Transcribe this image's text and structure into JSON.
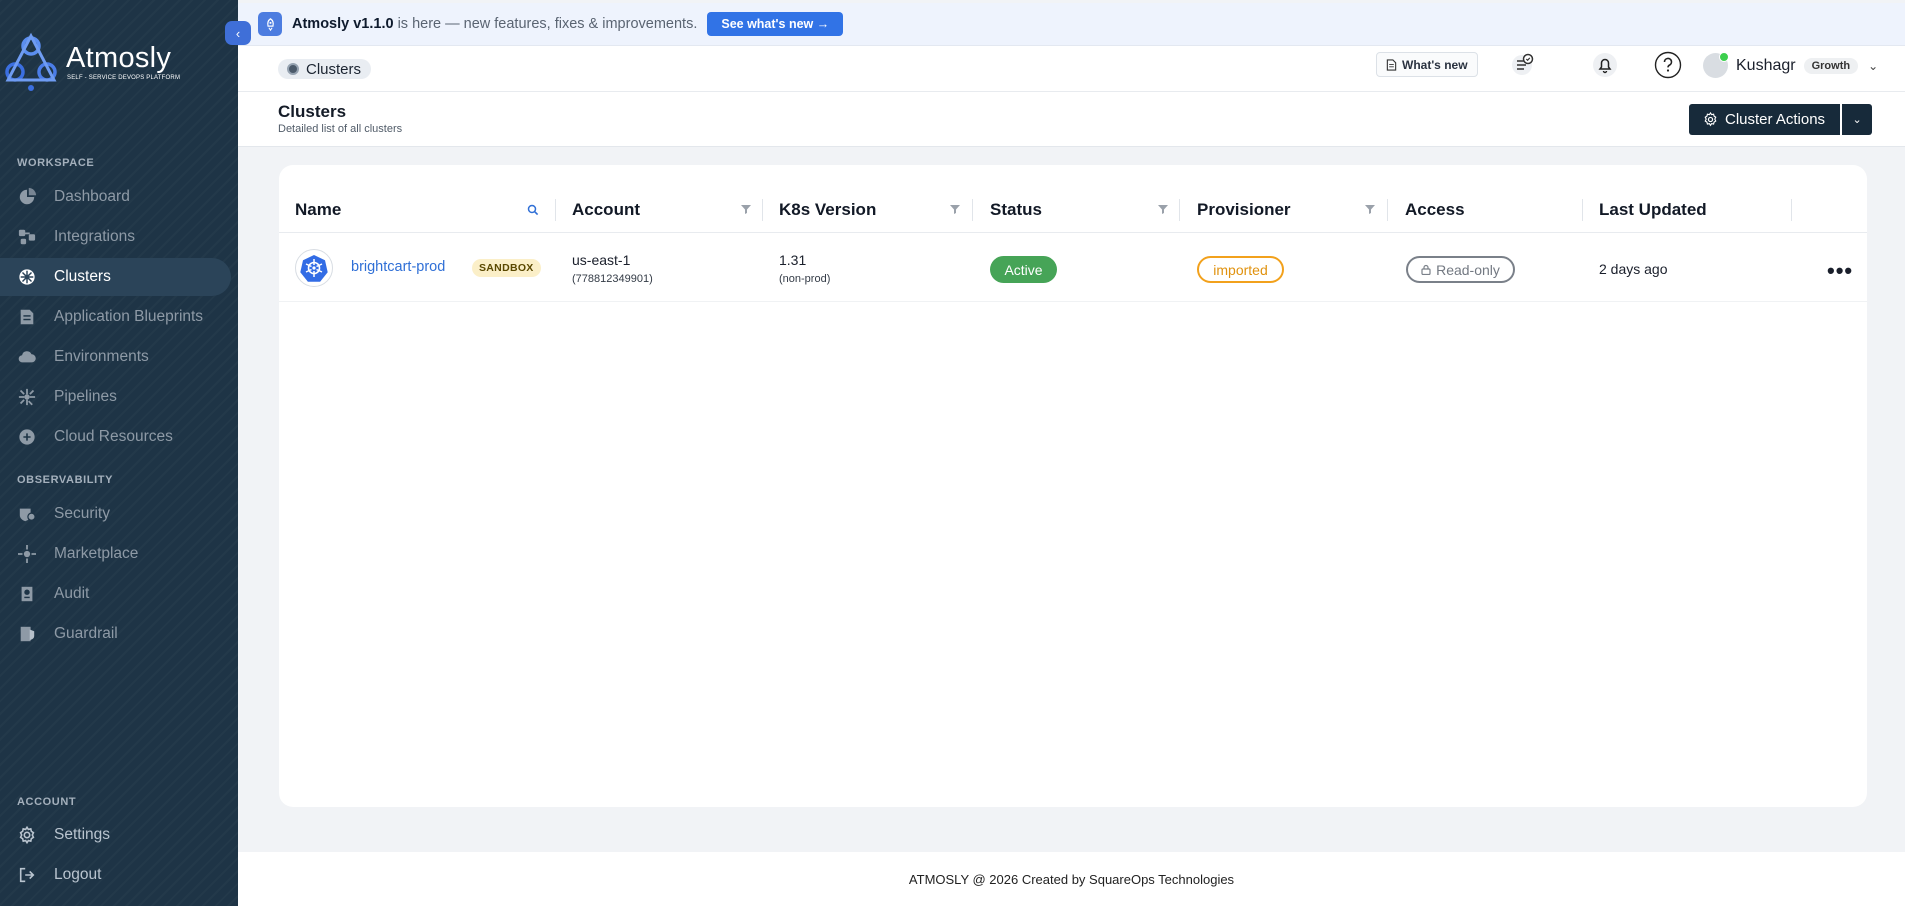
{
  "sidebar": {
    "logo_name": "Atmosly",
    "logo_tagline": "SELF - SERVICE DEVOPS PLATFORM",
    "sections": {
      "workspace": "WORKSPACE",
      "observability": "OBSERVABILITY",
      "account": "ACCOUNT"
    },
    "items": [
      {
        "label": "Dashboard",
        "icon": "dashboard-icon"
      },
      {
        "label": "Integrations",
        "icon": "integrations-icon"
      },
      {
        "label": "Clusters",
        "icon": "cluster-icon",
        "active": true
      },
      {
        "label": "Application Blueprints",
        "icon": "blueprint-icon"
      },
      {
        "label": "Environments",
        "icon": "cloud-icon"
      },
      {
        "label": "Pipelines",
        "icon": "pipeline-icon"
      },
      {
        "label": "Cloud Resources",
        "icon": "cloud-resources-icon"
      },
      {
        "label": "Security",
        "icon": "shield-icon"
      },
      {
        "label": "Marketplace",
        "icon": "marketplace-icon"
      },
      {
        "label": "Audit",
        "icon": "audit-icon"
      },
      {
        "label": "Guardrail",
        "icon": "guardrail-icon"
      },
      {
        "label": "Settings",
        "icon": "gear-icon"
      },
      {
        "label": "Logout",
        "icon": "logout-icon"
      }
    ]
  },
  "announcement": {
    "version_text": "Atmosly v1.1.0",
    "message": "is here — new features, fixes & improvements.",
    "button": "See what's new →"
  },
  "topbar": {
    "breadcrumb": "Clusters",
    "whats_new": "What's new",
    "user_name": "Kushagr",
    "plan": "Growth"
  },
  "page": {
    "title": "Clusters",
    "subtitle": "Detailed list of all clusters",
    "actions_button": "Cluster Actions"
  },
  "table": {
    "columns": [
      "Name",
      "Account",
      "K8s Version",
      "Status",
      "Provisioner",
      "Access",
      "Last Updated"
    ],
    "rows": [
      {
        "name": "brightcart-prod",
        "tag": "SANDBOX",
        "account_region": "us-east-1",
        "account_id": "(778812349901)",
        "k8s_version": "1.31",
        "env": "(non-prod)",
        "status": "Active",
        "provisioner": "imported",
        "access": "Read-only",
        "last_updated": "2 days ago"
      }
    ]
  },
  "footer": {
    "text": "ATMOSLY @ 2026 Created by SquareOps Technologies"
  },
  "colors": {
    "sidebar_bg": "#1e3446",
    "accent_blue": "#3173e6",
    "status_active": "#46a457",
    "provisioner_imported": "#f2a11c",
    "primary_dark": "#172a3a"
  }
}
